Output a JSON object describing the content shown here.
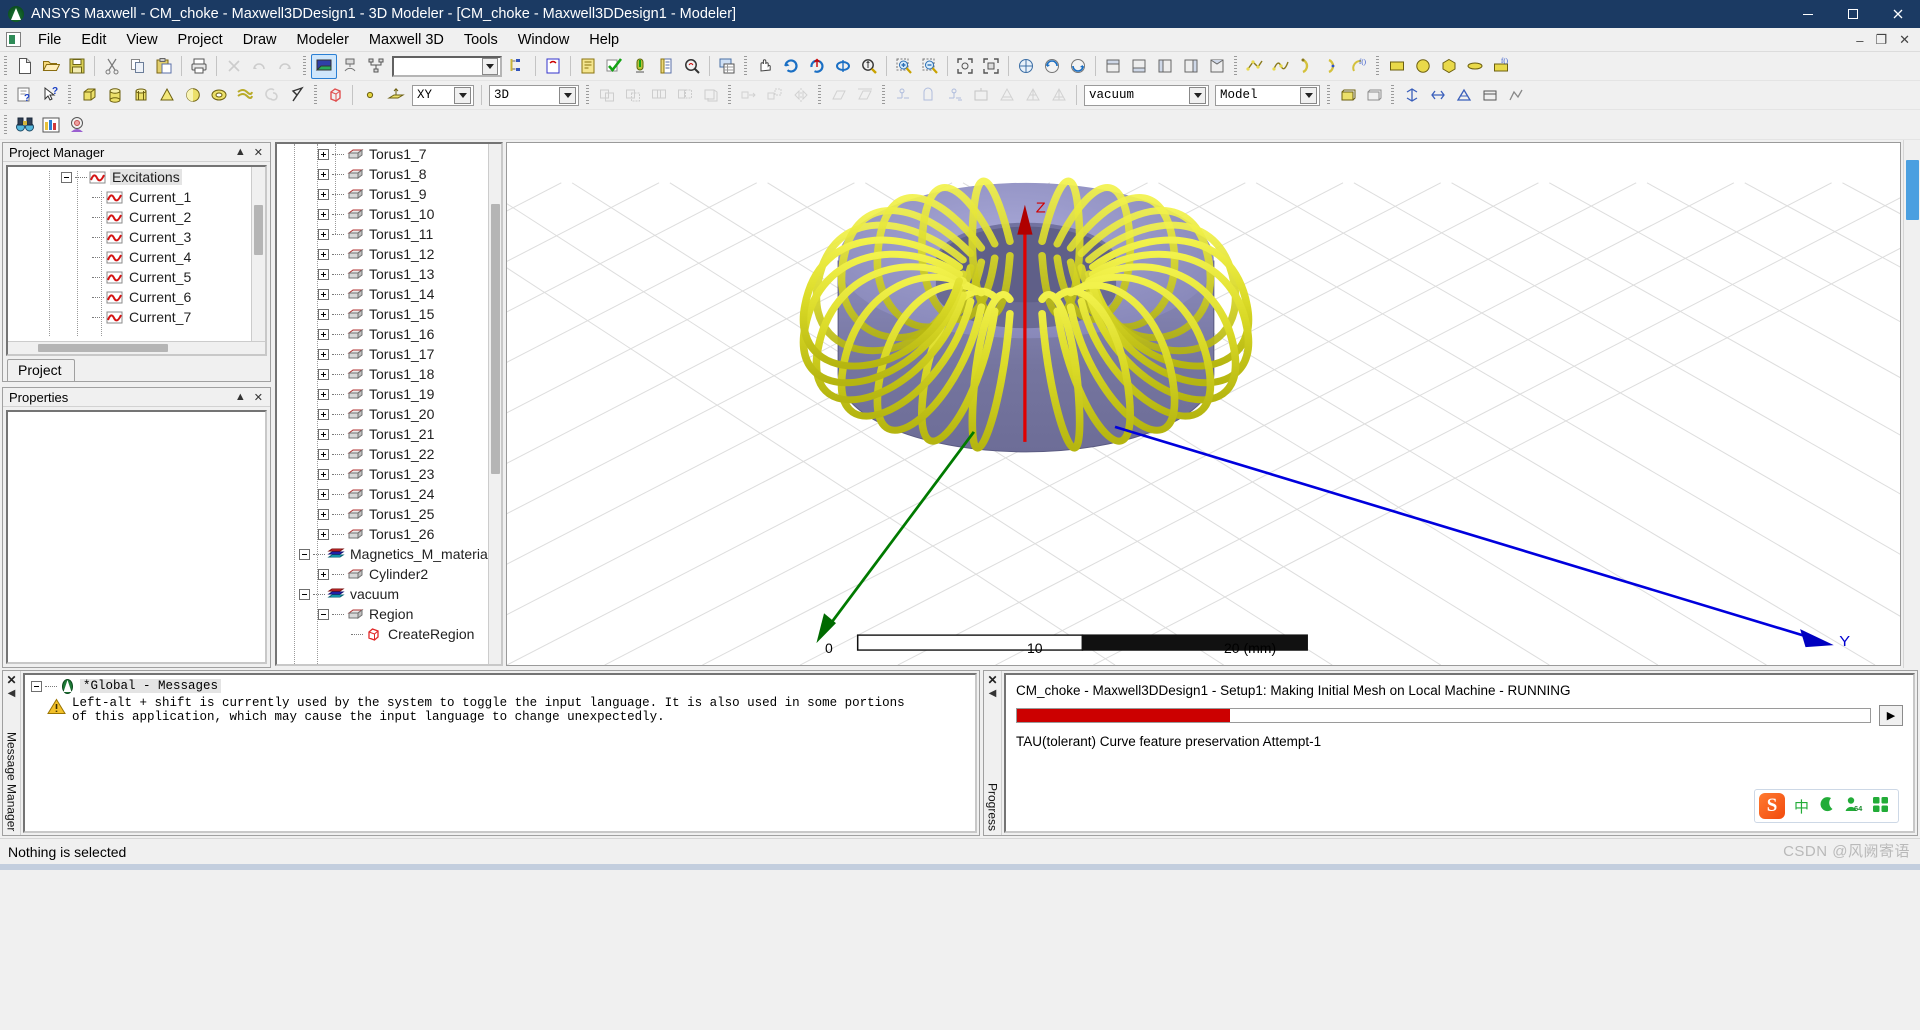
{
  "window": {
    "title": "ANSYS Maxwell - CM_choke - Maxwell3DDesign1 - 3D Modeler - [CM_choke - Maxwell3DDesign1 - Modeler]",
    "minimize": "─",
    "maximize": "□",
    "close": "✕",
    "doc_restore": "❐",
    "doc_close": "✕"
  },
  "menu": {
    "items": [
      {
        "label": "File",
        "accel": "F"
      },
      {
        "label": "Edit",
        "accel": "E"
      },
      {
        "label": "View",
        "accel": "V"
      },
      {
        "label": "Project",
        "accel": "P"
      },
      {
        "label": "Draw",
        "accel": "D"
      },
      {
        "label": "Modeler",
        "accel": "M"
      },
      {
        "label": "Maxwell 3D",
        "accel": "M"
      },
      {
        "label": "Tools",
        "accel": "T"
      },
      {
        "label": "Window",
        "accel": "W"
      },
      {
        "label": "Help",
        "accel": "H"
      }
    ]
  },
  "toolbars": {
    "search_box_value": "",
    "plane_combo": "XY",
    "dim_combo": "3D",
    "material_combo": "vacuum",
    "model_combo": "Model"
  },
  "project_manager": {
    "title": "Project Manager",
    "collapse_glyph": "▲",
    "close_glyph": "✕",
    "tab_label": "Project",
    "tree": {
      "root_label": "Excitations",
      "items": [
        "Current_1",
        "Current_2",
        "Current_3",
        "Current_4",
        "Current_5",
        "Current_6",
        "Current_7"
      ]
    }
  },
  "properties": {
    "title": "Properties",
    "collapse_glyph": "▲",
    "close_glyph": "✕"
  },
  "model_tree": {
    "torus_items": [
      "Torus1_7",
      "Torus1_8",
      "Torus1_9",
      "Torus1_10",
      "Torus1_11",
      "Torus1_12",
      "Torus1_13",
      "Torus1_14",
      "Torus1_15",
      "Torus1_16",
      "Torus1_17",
      "Torus1_18",
      "Torus1_19",
      "Torus1_20",
      "Torus1_21",
      "Torus1_22",
      "Torus1_23",
      "Torus1_24",
      "Torus1_25",
      "Torus1_26"
    ],
    "material_group": "Magnetics_M_material",
    "material_child": "Cylinder2",
    "vacuum_group": "vacuum",
    "vacuum_child": "Region",
    "vacuum_grandchild": "CreateRegion"
  },
  "viewport": {
    "axis_z": "Z",
    "axis_y": "Y",
    "scale_ticks": [
      "0",
      "10",
      "20 (mm)"
    ],
    "core_color": "#7b7bad",
    "core_color_light": "#9a9acb",
    "coil_color": "#d8d82a",
    "z_axis_color": "#e00000",
    "y_axis_color": "#0000e0",
    "x_axis_color": "#008000",
    "coil_turns": 26
  },
  "message_panel": {
    "strip_close": "✕",
    "strip_arrow": "◀",
    "strip_title": "Message Manager",
    "root_label": "*Global - Messages",
    "warning_line1": "Left-alt + shift is currently used by the system to toggle the input language. It is also used in some portions",
    "warning_line2": "of this application, which may cause the input language to change unexpectedly."
  },
  "progress_panel": {
    "strip_close": "✕",
    "strip_arrow": "◀",
    "strip_title": "Progress",
    "status_line": "CM_choke - Maxwell3DDesign1 - Setup1: Making Initial Mesh on Local Machine - RUNNING",
    "detail_line": "TAU(tolerant) Curve feature preservation   Attempt-1",
    "progress_percent": 25,
    "progress_color": "#cc0000",
    "expand_button": "▶"
  },
  "status_bar": {
    "text": "Nothing is selected"
  },
  "ime": {
    "logo": "S",
    "chinese_mode": "中",
    "moon": "☽",
    "person": "人",
    "badge": "64",
    "grid": "▦"
  },
  "watermark": {
    "text": "CSDN @风阙寄语"
  }
}
